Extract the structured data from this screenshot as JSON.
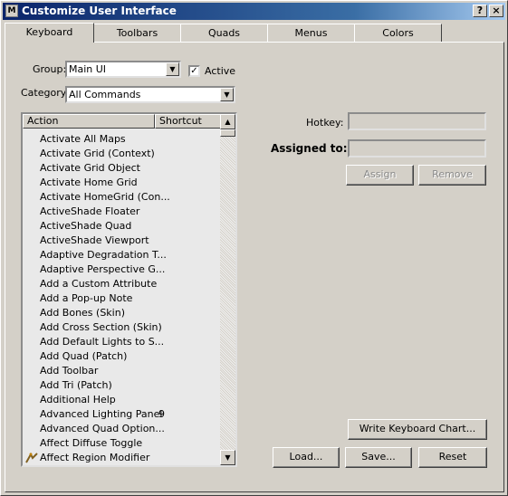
{
  "window": {
    "title": "Customize User Interface",
    "help_button": "?",
    "close_button": "×"
  },
  "tabs": [
    {
      "label": "Keyboard",
      "active": true
    },
    {
      "label": "Toolbars",
      "active": false
    },
    {
      "label": "Quads",
      "active": false
    },
    {
      "label": "Menus",
      "active": false
    },
    {
      "label": "Colors",
      "active": false
    }
  ],
  "keyboard": {
    "group_label": "Group:",
    "group_value": "Main UI",
    "active_label": "Active",
    "active_checked": true,
    "category_label": "Category:",
    "category_value": "All Commands",
    "list": {
      "columns": [
        "Action",
        "Shortcut"
      ],
      "rows": [
        {
          "action": "Activate All Maps",
          "shortcut": ""
        },
        {
          "action": "Activate Grid (Context)",
          "shortcut": ""
        },
        {
          "action": "Activate Grid Object",
          "shortcut": ""
        },
        {
          "action": "Activate Home Grid",
          "shortcut": ""
        },
        {
          "action": "Activate HomeGrid (Con...",
          "shortcut": ""
        },
        {
          "action": "ActiveShade Floater",
          "shortcut": ""
        },
        {
          "action": "ActiveShade Quad",
          "shortcut": ""
        },
        {
          "action": "ActiveShade Viewport",
          "shortcut": ""
        },
        {
          "action": "Adaptive Degradation T...",
          "shortcut": ""
        },
        {
          "action": "Adaptive Perspective G...",
          "shortcut": ""
        },
        {
          "action": "Add a Custom Attribute",
          "shortcut": ""
        },
        {
          "action": "Add a Pop-up Note",
          "shortcut": ""
        },
        {
          "action": "Add Bones (Skin)",
          "shortcut": ""
        },
        {
          "action": "Add Cross Section (Skin)",
          "shortcut": ""
        },
        {
          "action": "Add Default Lights to S...",
          "shortcut": ""
        },
        {
          "action": "Add Quad (Patch)",
          "shortcut": ""
        },
        {
          "action": "Add Toolbar",
          "shortcut": ""
        },
        {
          "action": "Add Tri (Patch)",
          "shortcut": ""
        },
        {
          "action": "Additional Help",
          "shortcut": ""
        },
        {
          "action": "Advanced Lighting Panel",
          "shortcut": "9"
        },
        {
          "action": "Advanced Quad Option...",
          "shortcut": ""
        },
        {
          "action": "Affect Diffuse Toggle",
          "shortcut": ""
        },
        {
          "action": "Affect Region Modifier",
          "shortcut": "",
          "icon": "affect-region-icon"
        }
      ]
    },
    "hotkey_label": "Hotkey:",
    "hotkey_value": "",
    "assigned_label": "Assigned to:",
    "assigned_value": "",
    "assign_button": "Assign",
    "remove_button": "Remove",
    "write_chart_button": "Write Keyboard Chart...",
    "load_button": "Load...",
    "save_button": "Save...",
    "reset_button": "Reset"
  },
  "colors": {
    "face": "#d4d0c8",
    "titlebar_start": "#0a246a"
  }
}
